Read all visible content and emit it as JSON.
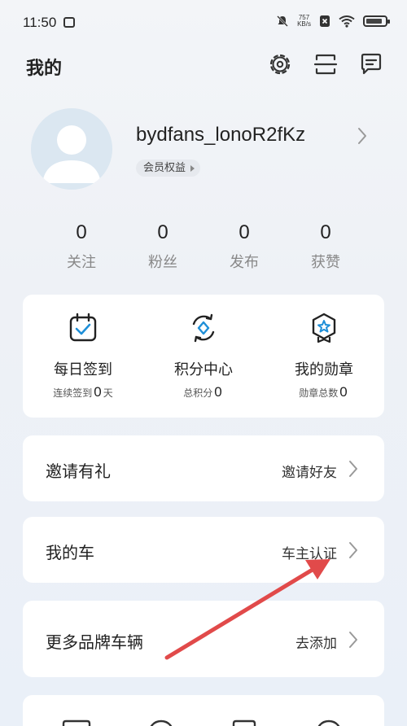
{
  "status_bar": {
    "time": "11:50",
    "net_speed_value": "757",
    "net_speed_unit": "KB/s",
    "battery_level": 0.85
  },
  "header": {
    "title": "我的",
    "icons": [
      "settings-icon",
      "scan-icon",
      "message-icon"
    ]
  },
  "profile": {
    "username": "bydfans_lonoR2fKz",
    "member_label": "会员权益"
  },
  "stats": [
    {
      "value": "0",
      "label": "关注"
    },
    {
      "value": "0",
      "label": "粉丝"
    },
    {
      "value": "0",
      "label": "发布"
    },
    {
      "value": "0",
      "label": "获赞"
    }
  ],
  "features": [
    {
      "title": "每日签到",
      "sub_prefix": "连续签到",
      "sub_value": "0",
      "sub_suffix": "天",
      "icon": "calendar-check-icon"
    },
    {
      "title": "积分中心",
      "sub_prefix": "总积分",
      "sub_value": "0",
      "sub_suffix": "",
      "icon": "points-icon"
    },
    {
      "title": "我的勋章",
      "sub_prefix": "勋章总数",
      "sub_value": "0",
      "sub_suffix": "",
      "icon": "medal-icon"
    }
  ],
  "rows": [
    {
      "label": "邀请有礼",
      "action": "邀请好友"
    },
    {
      "label": "我的车",
      "action": "车主认证"
    },
    {
      "label": "更多品牌车辆",
      "action": "去添加"
    }
  ],
  "colors": {
    "accent": "#1e8fd8",
    "annotation": "#e14a4a",
    "card": "#ffffff",
    "muted_text": "#888888"
  }
}
